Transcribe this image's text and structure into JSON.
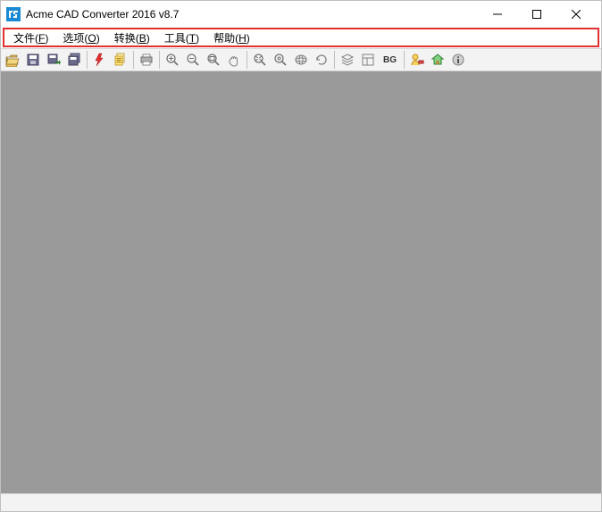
{
  "title": "Acme CAD Converter 2016 v8.7",
  "menu": {
    "file": {
      "label": "文件",
      "accel": "F"
    },
    "options": {
      "label": "选项",
      "accel": "O"
    },
    "convert": {
      "label": "转换",
      "accel": "B"
    },
    "tools": {
      "label": "工具",
      "accel": "T"
    },
    "help": {
      "label": "帮助",
      "accel": "H"
    }
  },
  "toolbar": {
    "bg_label": "BG"
  }
}
